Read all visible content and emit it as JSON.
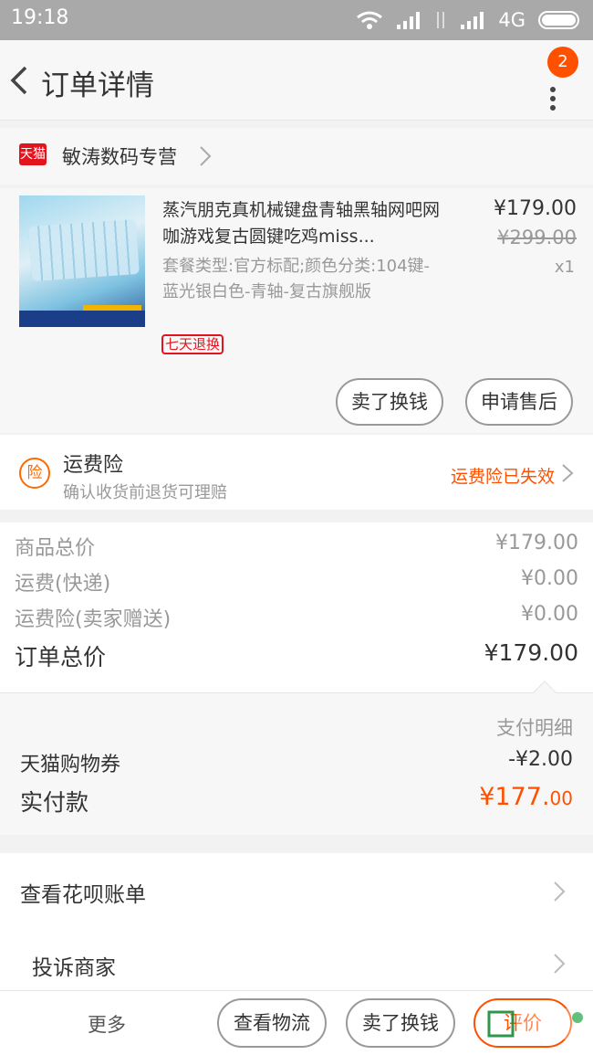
{
  "status_bar": {
    "time": "19:18",
    "network": "4G"
  },
  "nav": {
    "title": "订单详情",
    "badge_count": "2"
  },
  "store": {
    "logo_text": "天猫",
    "name": "敏涛数码专营"
  },
  "item": {
    "title": "蒸汽朋克真机械键盘青轴黑轴网吧网咖游戏复古圆键吃鸡miss...",
    "spec": "套餐类型:官方标配;颜色分类:104键-蓝光银白色-青轴-复古旗舰版",
    "price": "¥179.00",
    "original_price": "¥299.00",
    "quantity": "x1",
    "return_badge": "七天退换",
    "sell_button": "卖了换钱",
    "aftersale_button": "申请售后"
  },
  "insurance": {
    "icon_text": "险",
    "title": "运费险",
    "subtitle": "确认收货前退货可理赔",
    "status": "运费险已失效"
  },
  "prices": [
    {
      "label": "商品总价",
      "value": "¥179.00"
    },
    {
      "label": "运费(快递)",
      "value": "¥0.00"
    },
    {
      "label": "运费险(卖家赠送)",
      "value": "¥0.00"
    }
  ],
  "order_total": {
    "label": "订单总价",
    "value": "¥179.00"
  },
  "payment": {
    "detail_label": "支付明细",
    "coupon_label": "天猫购物券",
    "coupon_value": "-¥2.00",
    "paid_label": "实付款",
    "paid_main": "¥177.",
    "paid_cents": "00"
  },
  "links": {
    "huabei": "查看花呗账单",
    "complain": "投诉商家"
  },
  "bottom_bar": {
    "more": "更多",
    "logistics": "查看物流",
    "sell": "卖了换钱",
    "review": "评价"
  },
  "colors": {
    "accent": "#ff5000",
    "tmall_red": "#e4141f",
    "status_bar": "#a9a9a9"
  },
  "icons": [
    "back-arrow-icon",
    "more-vertical-icon",
    "wifi-icon",
    "signal-icon",
    "battery-icon",
    "chevron-right-icon",
    "tmall-logo-icon",
    "insurance-icon"
  ]
}
